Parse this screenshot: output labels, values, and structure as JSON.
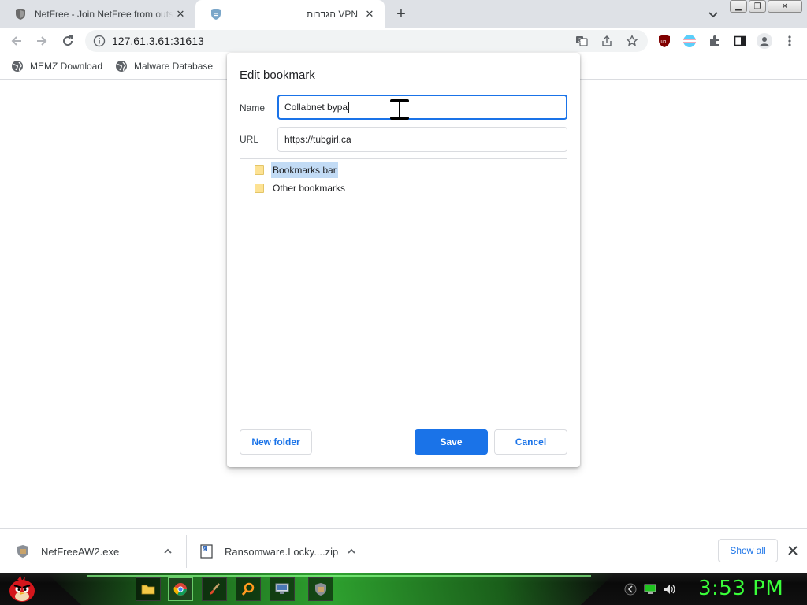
{
  "tabs": [
    {
      "title": "NetFree - Join NetFree from outs",
      "icon": "shield-icon"
    },
    {
      "title": "הגדרות VPN",
      "icon": "netfree-shield-icon"
    }
  ],
  "window_controls": [
    "minimize",
    "restore",
    "close"
  ],
  "address_bar": {
    "url": "127.61.3.61:31613"
  },
  "bookmarks_bar": [
    {
      "label": "MEMZ Download",
      "icon": "globe-icon"
    },
    {
      "label": "Malware Database",
      "icon": "globe-icon"
    }
  ],
  "dialog": {
    "title": "Edit bookmark",
    "name_label": "Name",
    "name_value": "Collabnet bypa",
    "url_label": "URL",
    "url_value": "https://tubgirl.ca",
    "folders": [
      {
        "label": "Bookmarks bar",
        "selected": true
      },
      {
        "label": "Other bookmarks",
        "selected": false
      }
    ],
    "new_folder_label": "New folder",
    "save_label": "Save",
    "cancel_label": "Cancel"
  },
  "downloads": {
    "items": [
      {
        "name": "NetFreeAW2.exe",
        "icon": "installer-icon"
      },
      {
        "name": "Ransomware.Locky....zip",
        "icon": "zip-archive-icon"
      }
    ],
    "show_all_label": "Show all"
  },
  "taskbar": {
    "clock": "3:53 PM"
  },
  "colors": {
    "accent": "#1a73e8",
    "clock": "#39ff39",
    "taskbar_glow": "#39d23a"
  }
}
